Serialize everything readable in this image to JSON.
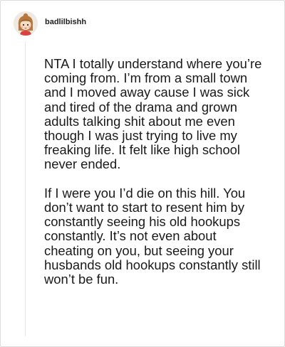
{
  "comment": {
    "username": "badlilbishh",
    "avatar_icon": "cartoon-girl-avatar-icon",
    "paragraphs": [
      "NTA I totally understand where you’re coming from. I’m from a small town and I moved away cause I was sick and tired of the drama and grown adults talking shit about me even though I was just trying to live my freaking life. It felt like high school never ended.",
      "If I were you I’d die on this hill. You don’t want to start to resent him by constantly seeing his old hookups constantly. It’s not even about cheating on you, but seeing your husbands old hookups constantly still won’t be fun."
    ]
  },
  "colors": {
    "text": "#1a1a1a",
    "border": "#dcdcdc",
    "thread_line": "#e6e6e6"
  }
}
